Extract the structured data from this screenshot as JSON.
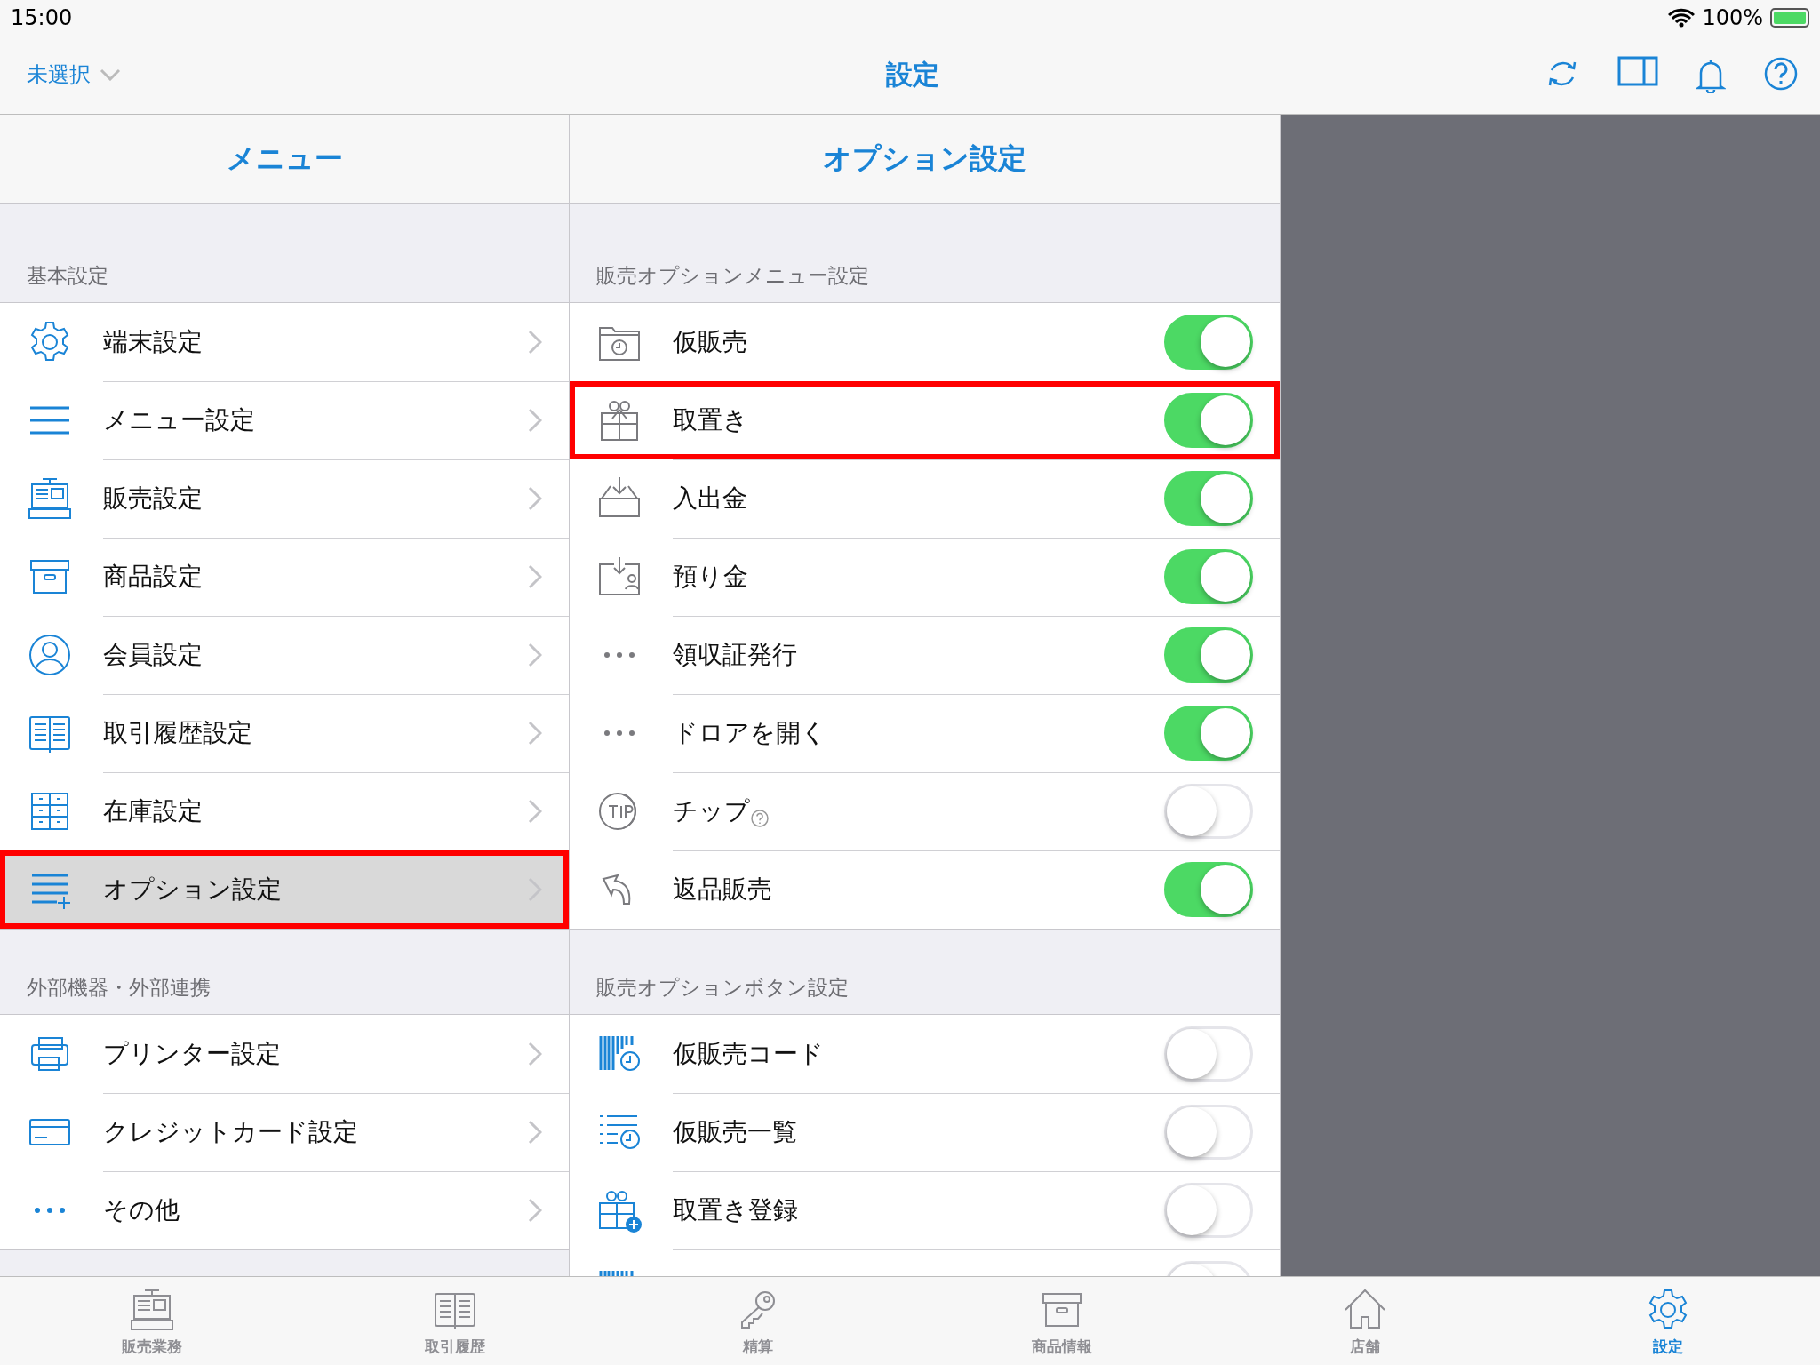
{
  "status_bar": {
    "time": "15:00",
    "battery": "100%"
  },
  "nav": {
    "store_picker": "未選択",
    "title": "設定"
  },
  "menu": {
    "title": "メニュー",
    "sections": [
      {
        "header": "基本設定",
        "items": [
          {
            "label": "端末設定",
            "selected": false
          },
          {
            "label": "メニュー設定",
            "selected": false
          },
          {
            "label": "販売設定",
            "selected": false
          },
          {
            "label": "商品設定",
            "selected": false
          },
          {
            "label": "会員設定",
            "selected": false
          },
          {
            "label": "取引履歴設定",
            "selected": false
          },
          {
            "label": "在庫設定",
            "selected": false
          },
          {
            "label": "オプション設定",
            "selected": true,
            "highlighted": true
          }
        ]
      },
      {
        "header": "外部機器・外部連携",
        "items": [
          {
            "label": "プリンター設定",
            "selected": false
          },
          {
            "label": "クレジットカード設定",
            "selected": false
          },
          {
            "label": "その他",
            "selected": false
          }
        ]
      }
    ]
  },
  "options": {
    "title": "オプション設定",
    "sections": [
      {
        "header": "販売オプションメニュー設定",
        "items": [
          {
            "label": "仮販売",
            "on": true
          },
          {
            "label": "取置き",
            "on": true,
            "highlighted": true
          },
          {
            "label": "入出金",
            "on": true
          },
          {
            "label": "預り金",
            "on": true
          },
          {
            "label": "領収証発行",
            "on": true
          },
          {
            "label": "ドロアを開く",
            "on": true
          },
          {
            "label": "チップ",
            "on": false,
            "help": true
          },
          {
            "label": "返品販売",
            "on": true
          }
        ]
      },
      {
        "header": "販売オプションボタン設定",
        "items": [
          {
            "label": "仮販売コード",
            "on": false
          },
          {
            "label": "仮販売一覧",
            "on": false
          },
          {
            "label": "取置き登録",
            "on": false
          },
          {
            "on": false
          }
        ]
      }
    ]
  },
  "tab_bar": [
    {
      "label": "販売業務",
      "selected": false
    },
    {
      "label": "取引履歴",
      "selected": false
    },
    {
      "label": "精算",
      "selected": false
    },
    {
      "label": "商品情報",
      "selected": false
    },
    {
      "label": "店舗",
      "selected": false
    },
    {
      "label": "設定",
      "selected": true
    }
  ]
}
